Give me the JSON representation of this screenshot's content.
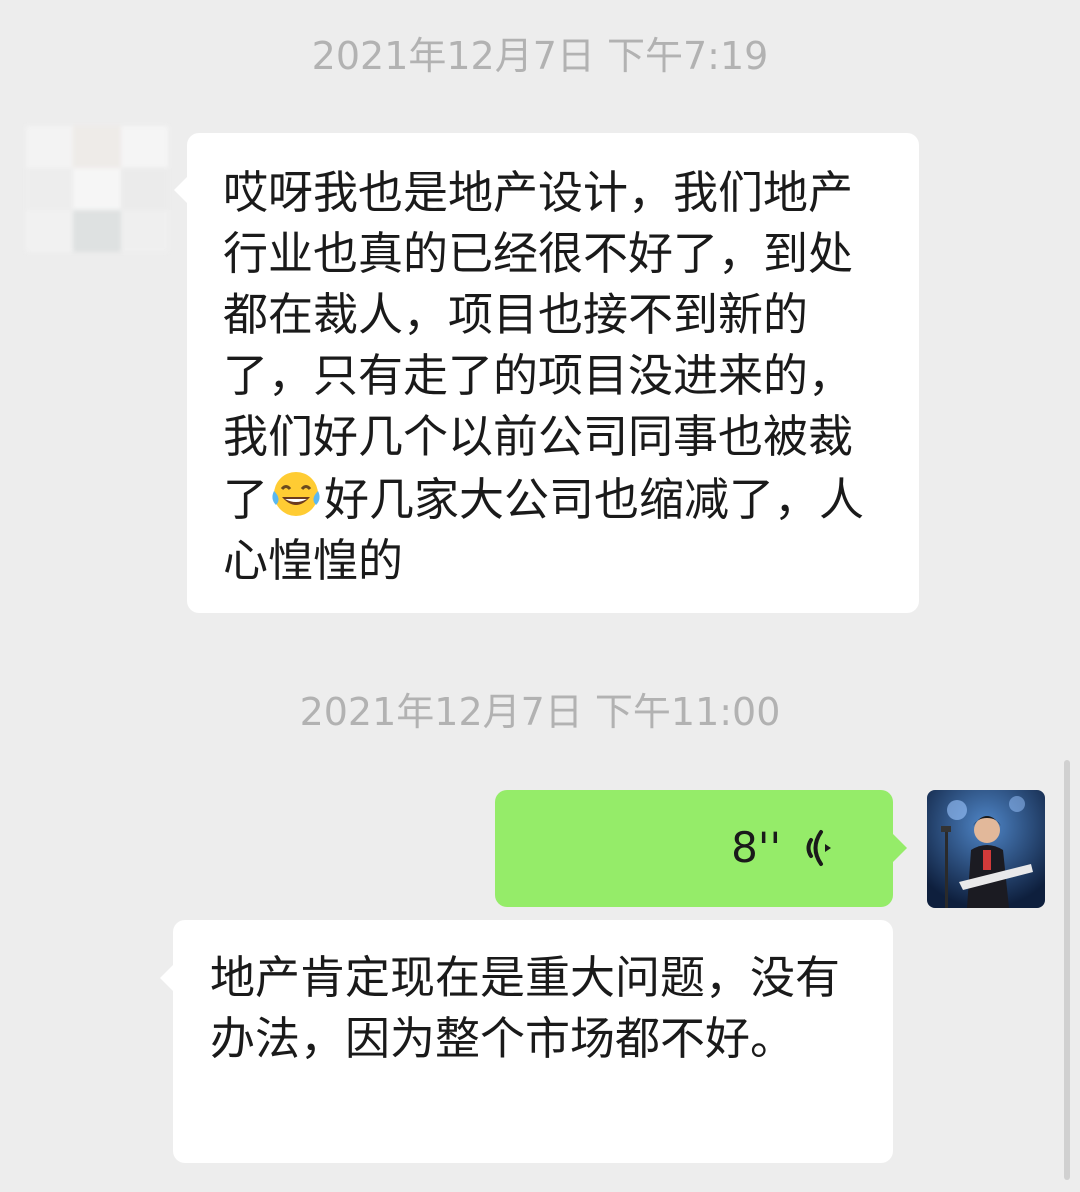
{
  "chat": {
    "timestamp_1": "2021年12月7日 下午7:19",
    "message_1_before_emoji": "哎呀我也是地产设计，我们地产行业也真的已经很不好了，到处都在裁人，项目也接不到新的了，只有走了的项目没进来的，我们好几个以前公司同事也被裁了",
    "message_1_emoji": "tears-of-joy-emoji",
    "message_1_after_emoji": "好几家大公司也缩减了，人心惶惶的",
    "timestamp_2": "2021年12月7日 下午11:00",
    "voice_message": {
      "duration": "8''",
      "icon": "voice-wave-icon"
    },
    "message_3": "地产肯定现在是重大问题，没有办法，因为整个市场都不好。"
  },
  "colors": {
    "background": "#ededed",
    "incoming_bubble": "#ffffff",
    "outgoing_bubble": "#95ec69",
    "timestamp_text": "#b2b2b2"
  }
}
